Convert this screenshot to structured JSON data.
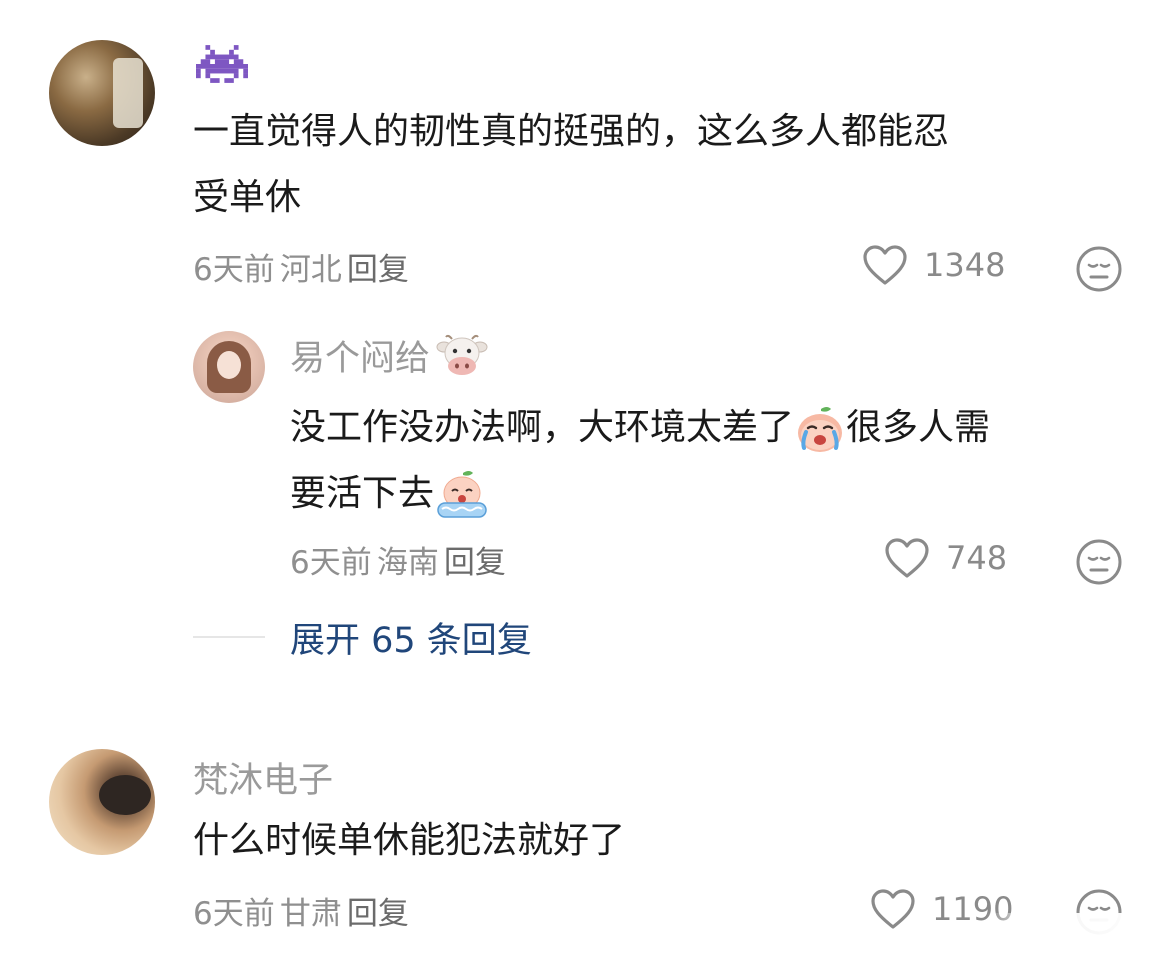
{
  "comments": [
    {
      "avatar_icon": "horse-avatar",
      "username_icon": "purple-space-invader-icon",
      "text_line1": "一直觉得人的韧性真的挺强的，这么多人都能忍",
      "text_line2": "受单休",
      "time": "6天前",
      "location": "河北",
      "reply_label": "回复",
      "likes": "1348",
      "reply": {
        "avatar_icon": "girl-avatar",
        "username": "易个闷给",
        "username_icon": "cow-face-icon",
        "text_line1_a": "没工作没办法啊，大环境太差了",
        "text_line1_b": "很多人需",
        "text_line2": "要活下去",
        "time": "6天前",
        "location": "海南",
        "reply_label": "回复",
        "likes": "748"
      },
      "expand_label": "展开 65 条回复"
    },
    {
      "avatar_icon": "shiba-dog-avatar",
      "username": "梵沐电子",
      "text": "什么时候单休能犯法就好了",
      "time": "6天前",
      "location": "甘肃",
      "reply_label": "回复",
      "likes": "1190"
    }
  ],
  "colors": {
    "expand_link": "#20467a",
    "meta_gray": "#8f8f8f",
    "name_gray": "#9a9a9a"
  }
}
